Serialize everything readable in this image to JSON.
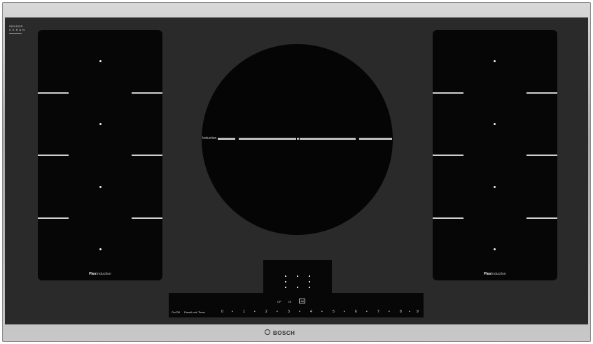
{
  "frame": {
    "brand": "BOSCH"
  },
  "glass": {
    "sensor_logo_line1": "SENSOR",
    "sensor_logo_line2": "C E R A N",
    "flex_left": {
      "bold": "Flex",
      "text": "Induction"
    },
    "flex_right": {
      "bold": "Flex",
      "text": "Induction"
    },
    "center_label": "Induction"
  },
  "controls": {
    "btn_top_left": "CP",
    "btn_top_mid": "Dt",
    "btn_top_right": "1st",
    "left_labels": [
      "On/Off",
      "PanelLock",
      "Timer"
    ],
    "scale": [
      "0",
      "•",
      "1",
      "•",
      "2",
      "•",
      "3",
      "•",
      "4",
      "•",
      "5",
      "•",
      "6",
      "•",
      "7",
      "•",
      "8",
      "•",
      "9"
    ]
  }
}
